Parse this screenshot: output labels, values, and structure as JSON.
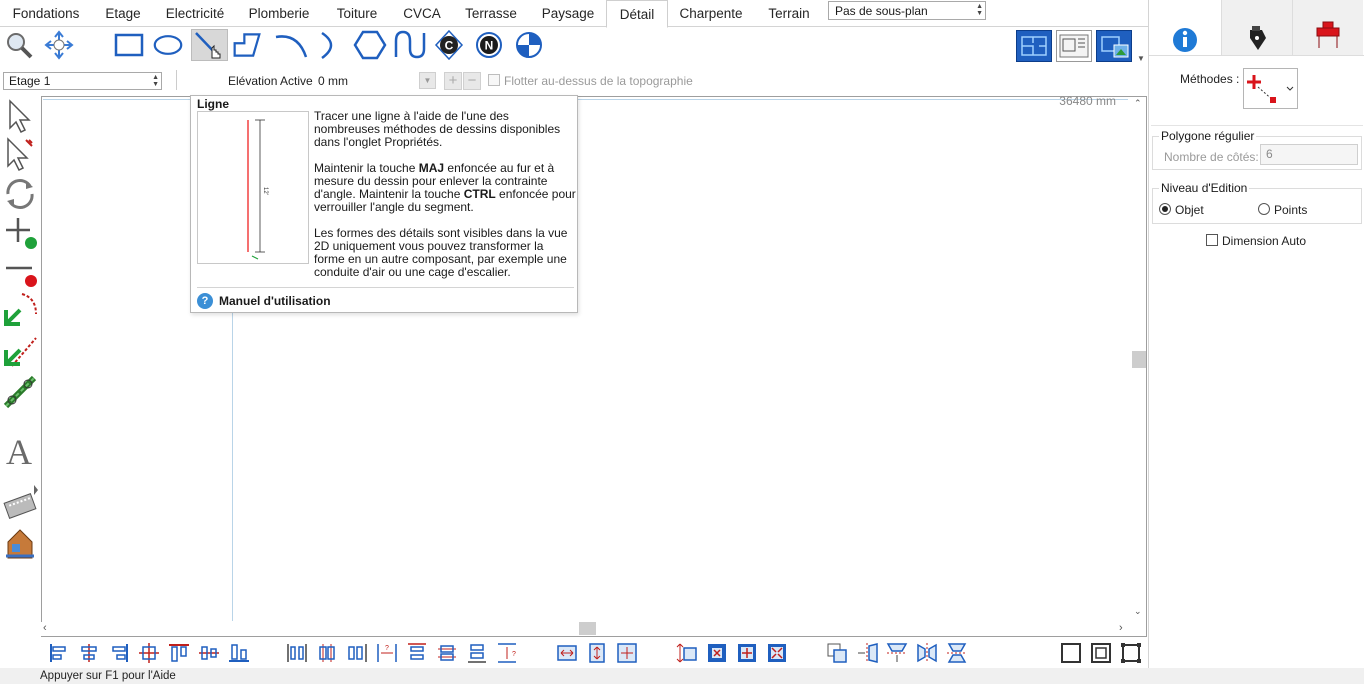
{
  "tabs": [
    "Fondations",
    "Etage",
    "Electricité",
    "Plomberie",
    "Toiture",
    "CVCA",
    "Terrasse",
    "Paysage",
    "Détail",
    "Charpente",
    "Terrain"
  ],
  "active_tab": "Détail",
  "subplan_select": "Pas de sous-plan",
  "floor_select": "Etage 1",
  "elevation": {
    "label": "Elévation Active:",
    "value": "0 mm"
  },
  "topo_checkbox": "Flotter au-dessus de la topographie",
  "ruler_text": "36480 mm",
  "tooltip": {
    "title": "Ligne",
    "p1": "Tracer une ligne à l'aide de l'une des nombreuses méthodes de dessins disponibles dans l'onglet Propriétés.",
    "p2a": "Maintenir la touche ",
    "p2b": "MAJ",
    "p2c": " enfoncée au fur et à mesure du dessin pour enlever la contrainte d'angle. Maintenir la touche ",
    "p2d": "CTRL",
    "p2e": " enfoncée pour verrouiller l'angle du segment.",
    "p3": "Les formes des détails sont visibles dans la vue 2D uniquement vous pouvez transformer la forme en un autre composant, par exemple une conduite d'air ou une cage d'escalier.",
    "help": "Manuel d'utilisation"
  },
  "right_panel": {
    "methods_label": "Méthodes :",
    "polygon_group": "Polygone régulier",
    "sides_label": "Nombre de côtés:",
    "sides_value": "6",
    "edit_group": "Niveau d'Edition",
    "radio_object": "Objet",
    "radio_points": "Points",
    "auto_dim": "Dimension Auto"
  },
  "status_bar": "Appuyer sur F1 pour l'Aide",
  "colors": {
    "accent_blue": "#1f5fbf",
    "tab_border": "#cfcfcf",
    "red": "#d9141b",
    "green": "#1fa13a"
  }
}
